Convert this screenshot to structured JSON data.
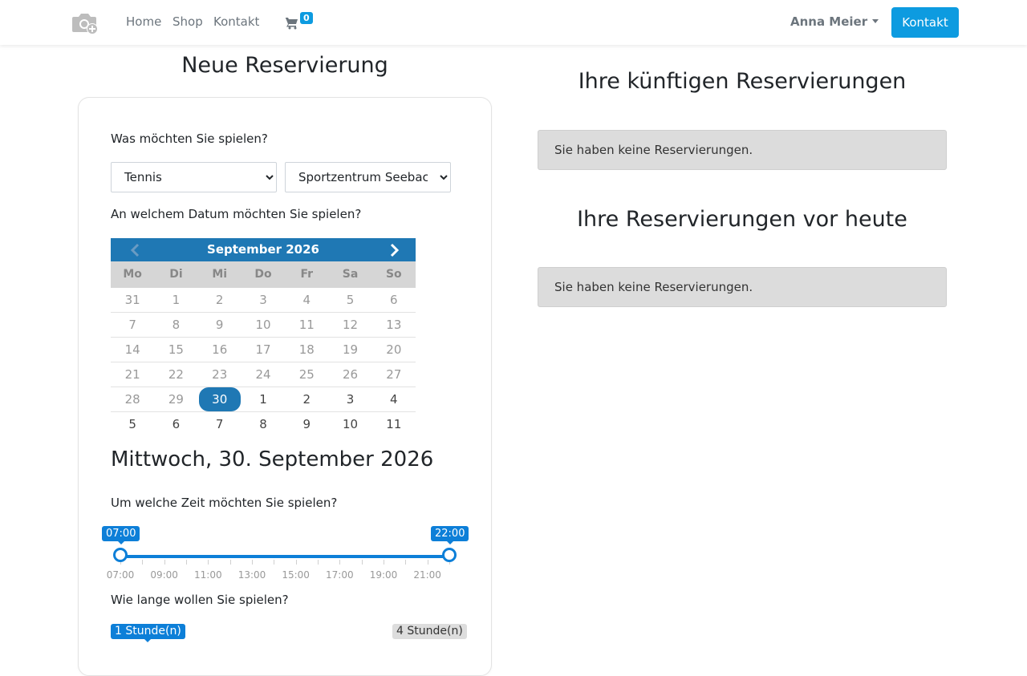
{
  "nav": {
    "links": [
      "Home",
      "Shop",
      "Kontakt"
    ],
    "cart_count": "0",
    "user_name": "Anna Meier",
    "kontakt_button": "Kontakt"
  },
  "reservation": {
    "title": "Neue Reservierung",
    "what_label": "Was möchten Sie spielen?",
    "sport_selected": "Tennis",
    "venue_selected": "Sportzentrum Seebach",
    "date_label": "An welchem Datum möchten Sie spielen?",
    "calendar": {
      "month": "September 2026",
      "weekdays": [
        "Mo",
        "Di",
        "Mi",
        "Do",
        "Fr",
        "Sa",
        "So"
      ],
      "weeks": [
        [
          "31",
          "1",
          "2",
          "3",
          "4",
          "5",
          "6"
        ],
        [
          "7",
          "8",
          "9",
          "10",
          "11",
          "12",
          "13"
        ],
        [
          "14",
          "15",
          "16",
          "17",
          "18",
          "19",
          "20"
        ],
        [
          "21",
          "22",
          "23",
          "24",
          "25",
          "26",
          "27"
        ],
        [
          "28",
          "29",
          "30",
          "1",
          "2",
          "3",
          "4"
        ],
        [
          "5",
          "6",
          "7",
          "8",
          "9",
          "10",
          "11"
        ]
      ],
      "selected_day": "30"
    },
    "selected_date_title": "Mittwoch, 30. September 2026",
    "time_label": "Um welche Zeit möchten Sie spielen?",
    "time_range": {
      "from": "07:00",
      "to": "22:00"
    },
    "time_ticks": [
      "07:00",
      "09:00",
      "11:00",
      "13:00",
      "15:00",
      "17:00",
      "19:00",
      "21:00"
    ],
    "duration_label": "Wie lange wollen Sie spielen?",
    "duration_min": "1 Stunde(n)",
    "duration_max": "4 Stunde(n)"
  },
  "upcoming": {
    "title": "Ihre künftigen Reservierungen",
    "empty_message": "Sie haben keine Reservierungen."
  },
  "past": {
    "title": "Ihre Reservierungen vor heute",
    "empty_message": "Sie haben keine Reservierungen."
  },
  "colors": {
    "accent": "#0d9be0",
    "calendar_header": "#1f78b4",
    "slider": "#0d7fd8"
  }
}
